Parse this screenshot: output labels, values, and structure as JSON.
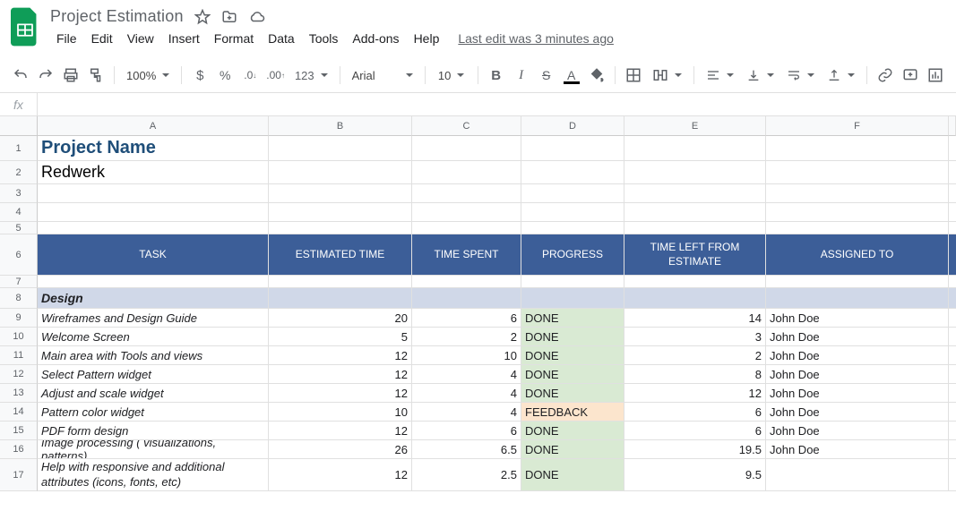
{
  "doc_title": "Project Estimation",
  "menus": [
    "File",
    "Edit",
    "View",
    "Insert",
    "Format",
    "Data",
    "Tools",
    "Add-ons",
    "Help"
  ],
  "last_edit": "Last edit was 3 minutes ago",
  "toolbar": {
    "zoom": "100%",
    "font": "Arial",
    "font_size": "10",
    "more_formats": "123"
  },
  "columns": [
    "A",
    "B",
    "C",
    "D",
    "E",
    "F"
  ],
  "row_numbers": [
    "1",
    "2",
    "3",
    "4",
    "5",
    "6",
    "7",
    "8",
    "9",
    "10",
    "11",
    "12",
    "13",
    "14",
    "15",
    "16",
    "17"
  ],
  "headers": {
    "a": "TASK",
    "b": "ESTIMATED TIME",
    "c": "TIME SPENT",
    "d": "PROGRESS",
    "e": "TIME LEFT FROM\nESTIMATE",
    "f": "ASSIGNED TO"
  },
  "title_cell": "Project Name",
  "company_cell": "Redwerk",
  "section": "Design",
  "status": {
    "done": "DONE",
    "feedback": "FEEDBACK"
  },
  "rows": [
    {
      "task": "Wireframes and Design Guide",
      "est": "20",
      "spent": "6",
      "prog": "done",
      "left": "14",
      "who": "John Doe"
    },
    {
      "task": "Welcome Screen",
      "est": "5",
      "spent": "2",
      "prog": "done",
      "left": "3",
      "who": "John Doe"
    },
    {
      "task": "Main area with Tools and views",
      "est": "12",
      "spent": "10",
      "prog": "done",
      "left": "2",
      "who": "John Doe"
    },
    {
      "task": "Select Pattern widget",
      "est": "12",
      "spent": "4",
      "prog": "done",
      "left": "8",
      "who": "John Doe"
    },
    {
      "task": "Adjust and scale widget",
      "est": "12",
      "spent": "4",
      "prog": "done",
      "left": "12",
      "who": "John Doe"
    },
    {
      "task": "Pattern color widget",
      "est": "10",
      "spent": "4",
      "prog": "feedback",
      "left": "6",
      "who": "John Doe"
    },
    {
      "task": "PDF form design",
      "est": "12",
      "spent": "6",
      "prog": "done",
      "left": "6",
      "who": "John Doe"
    },
    {
      "task": "Image processing ( visualizations, patterns)",
      "est": "26",
      "spent": "6.5",
      "prog": "done",
      "left": "19.5",
      "who": "John Doe"
    },
    {
      "task": "Help with responsive and additional attributes (icons, fonts, etc)",
      "est": "12",
      "spent": "2.5",
      "prog": "done",
      "left": "9.5",
      "who": ""
    }
  ],
  "chart_data": {
    "type": "table",
    "title": "Project Estimation — Design",
    "columns": [
      "TASK",
      "ESTIMATED TIME",
      "TIME SPENT",
      "PROGRESS",
      "TIME LEFT FROM ESTIMATE",
      "ASSIGNED TO"
    ],
    "rows": [
      [
        "Wireframes and Design Guide",
        20,
        6,
        "DONE",
        14,
        "John Doe"
      ],
      [
        "Welcome Screen",
        5,
        2,
        "DONE",
        3,
        "John Doe"
      ],
      [
        "Main area with Tools and views",
        12,
        10,
        "DONE",
        2,
        "John Doe"
      ],
      [
        "Select Pattern widget",
        12,
        4,
        "DONE",
        8,
        "John Doe"
      ],
      [
        "Adjust and scale widget",
        12,
        4,
        "DONE",
        12,
        "John Doe"
      ],
      [
        "Pattern color widget",
        10,
        4,
        "FEEDBACK",
        6,
        "John Doe"
      ],
      [
        "PDF form design",
        12,
        6,
        "DONE",
        6,
        "John Doe"
      ],
      [
        "Image processing ( visualizations, patterns)",
        26,
        6.5,
        "DONE",
        19.5,
        "John Doe"
      ],
      [
        "Help with responsive and additional attributes (icons, fonts, etc)",
        12,
        2.5,
        "DONE",
        9.5,
        ""
      ]
    ]
  }
}
